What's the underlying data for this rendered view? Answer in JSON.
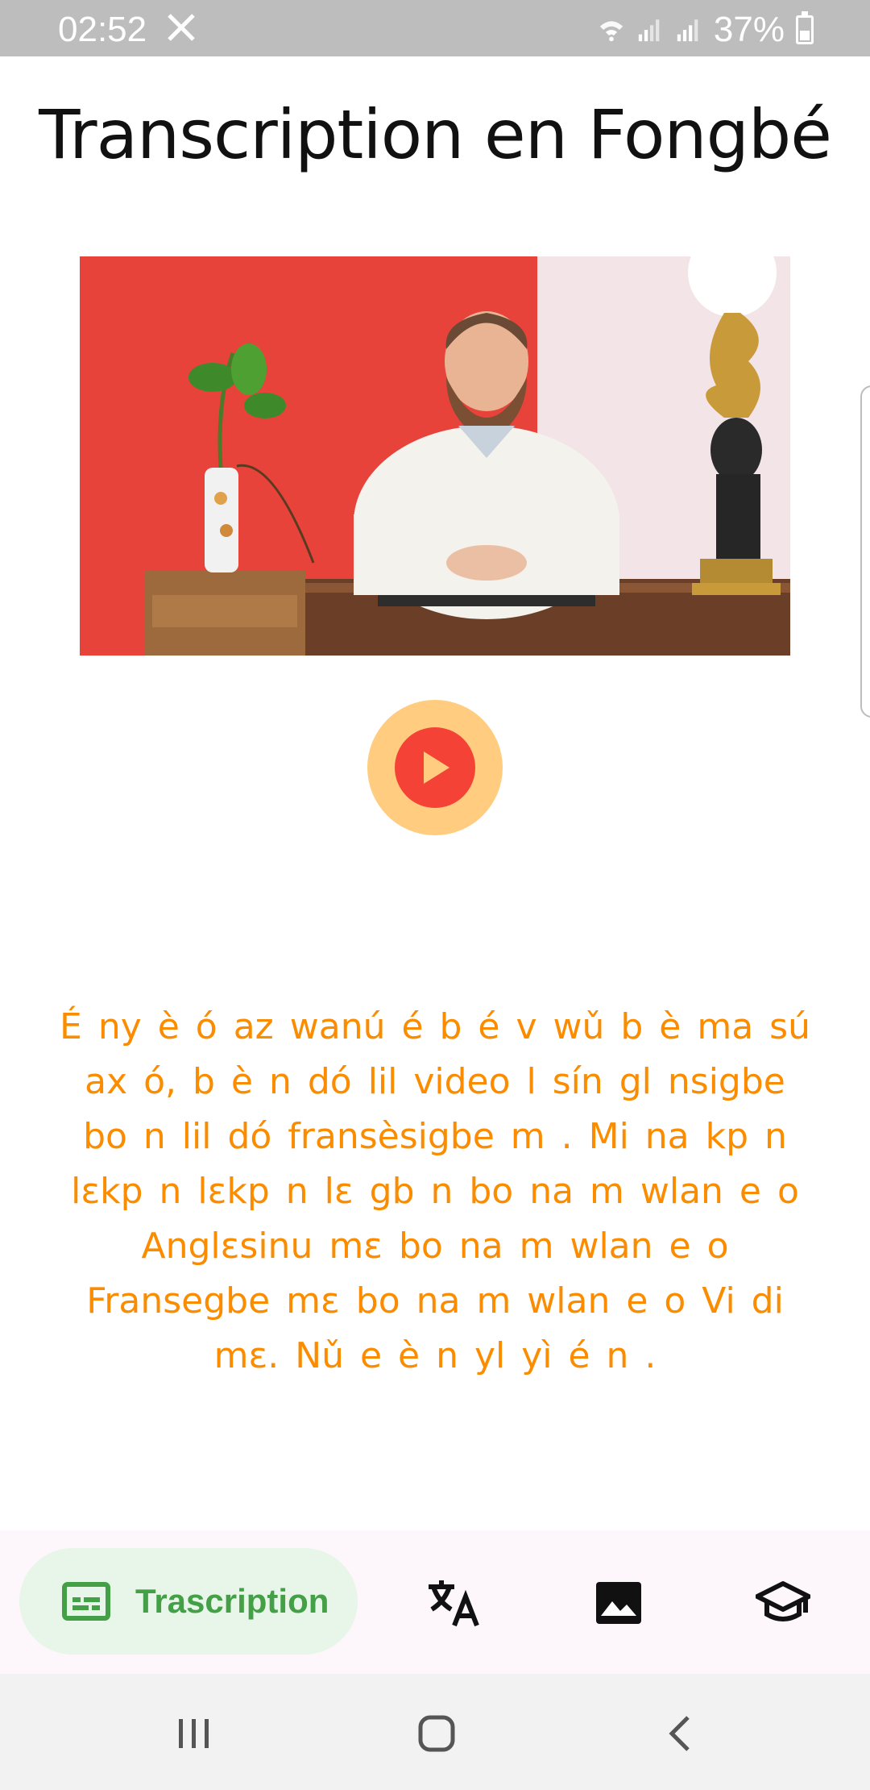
{
  "status_bar": {
    "time": "02:52",
    "battery_percent": "37%",
    "icons": [
      "x-logo-icon",
      "wifi-icon",
      "signal-icon",
      "signal-icon",
      "battery-icon"
    ]
  },
  "header": {
    "title": "Transcription en Fongbé"
  },
  "video": {
    "icon": "play-icon"
  },
  "transcript": {
    "text": "É ny          è     ó az    wanú     é b     é v    wǔ b     è ma sú ax     ó, b     è n     dó lil     video l      sín gl    nsigbe bo n     lil     dó fransèsigbe m     . Mi na kp     n lɛkp     n lɛkp     n lɛ gb     n bo na m     wlan e     o Anglɛsinu mɛ       bo na m       wlan e     o Fransegbe mɛ       bo na m     wlan e     o Vi     di          mɛ. Nǔ e è n     yl               yì é n     ."
  },
  "bottom_nav": {
    "active_label": "Trascription",
    "items": [
      "subtitles-icon",
      "translate-icon",
      "image-icon",
      "school-icon"
    ]
  },
  "system_nav": {
    "items": [
      "recents-icon",
      "home-icon",
      "back-icon"
    ]
  },
  "colors": {
    "accent_orange": "#fb8c00",
    "play_outer": "#ffcc80",
    "play_inner": "#f44336",
    "nav_active_bg": "#e8f5e9",
    "nav_active_fg": "#43a047"
  }
}
